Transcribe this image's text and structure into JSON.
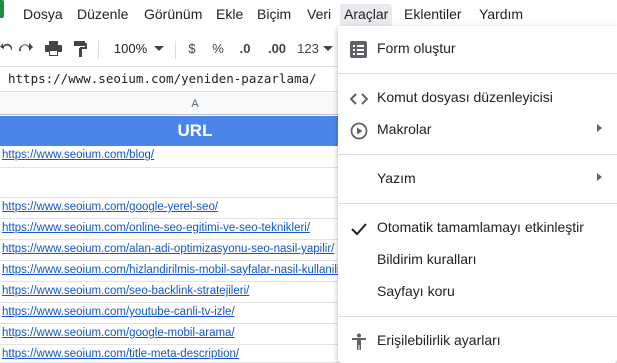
{
  "menubar": {
    "items": [
      "Dosya",
      "Düzenle",
      "Görünüm",
      "Ekle",
      "Biçim",
      "Veri",
      "Araçlar",
      "Eklentiler",
      "Yardım"
    ],
    "active": "Araçlar"
  },
  "toolbar": {
    "undo_icon": "undo-icon",
    "redo_icon": "redo-icon",
    "print_icon": "print-icon",
    "paint_format_icon": "paint-format-icon",
    "zoom": "100%",
    "currency": "$",
    "percent": "%",
    "decrease_decimal": ".0",
    "increase_decimal": ".00",
    "more_formats": "123"
  },
  "formula_bar": {
    "value": "https://www.seoium.com/yeniden-pazarlama/"
  },
  "sheet": {
    "column_a_header": "A",
    "header_cell": "URL",
    "header_color": "#4a86e8",
    "rows": [
      "https://www.seoium.com/blog/",
      "",
      "https://www.seoium.com/google-yerel-seo/",
      "https://www.seoium.com/online-seo-egitimi-ve-seo-teknikleri/",
      "https://www.seoium.com/alan-adi-optimizasyonu-seo-nasil-yapilir/",
      "https://www.seoium.com/hizlandirilmis-mobil-sayfalar-nasil-kullanilir/",
      "https://www.seoium.com/seo-backlink-stratejileri/",
      "https://www.seoium.com/youtube-canli-tv-izle/",
      "https://www.seoium.com/google-mobil-arama/",
      "https://www.seoium.com/title-meta-description/"
    ]
  },
  "tools_menu": {
    "items": {
      "form": {
        "label": "Form oluştur",
        "icon": "form-icon"
      },
      "script_editor": {
        "label": "Komut dosyası düzenleyicisi",
        "icon": "code-icon"
      },
      "macros": {
        "label": "Makrolar",
        "icon": "play-circle-icon"
      },
      "spelling": {
        "label": "Yazım"
      },
      "autocomplete": {
        "label": "Otomatik tamamlamayı etkinleştir",
        "icon": "checkmark-icon"
      },
      "notification_rules": {
        "label": "Bildirim kuralları"
      },
      "protect_sheet": {
        "label": "Sayfayı koru"
      },
      "accessibility": {
        "label": "Erişilebilirlik ayarları",
        "icon": "accessibility-icon"
      }
    }
  }
}
